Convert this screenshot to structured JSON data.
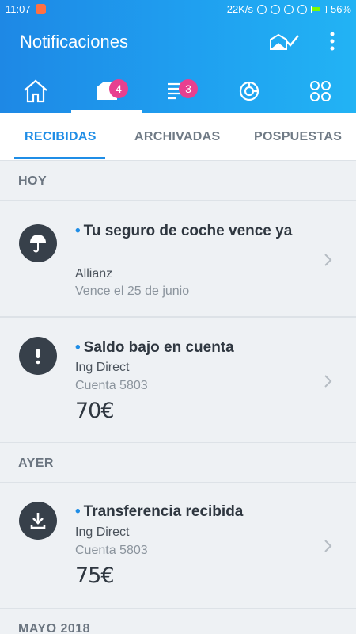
{
  "status_bar": {
    "time": "11:07",
    "speed": "22K/s",
    "battery": "56%"
  },
  "header": {
    "title": "Notificaciones"
  },
  "nav_tabs": [
    {
      "name": "inicio",
      "badge": ""
    },
    {
      "name": "notificaciones",
      "badge": "4"
    },
    {
      "name": "movimientos",
      "badge": "3"
    },
    {
      "name": "analisis",
      "badge": ""
    },
    {
      "name": "mas",
      "badge": ""
    }
  ],
  "subtabs": {
    "received": "RECIBIDAS",
    "archived": "ARCHIVADAS",
    "postponed": "POSPUESTAS"
  },
  "sections": {
    "today": "HOY",
    "yesterday": "AYER",
    "may": "MAYO 2018"
  },
  "notifications": [
    {
      "title": "Tu seguro de coche vence ya",
      "line1": "Allianz",
      "line2": "Vence el 25 de junio",
      "amount": "",
      "icon": "umbrella-icon"
    },
    {
      "title": "Saldo bajo en cuenta",
      "line1": "Ing Direct",
      "line2": "Cuenta 5803",
      "amount": "70€",
      "icon": "alert-icon"
    },
    {
      "title": "Transferencia recibida",
      "line1": "Ing Direct",
      "line2": "Cuenta 5803",
      "amount": "75€",
      "icon": "download-icon"
    }
  ],
  "colors": {
    "primary": "#1f8de6",
    "badge": "#e8408f",
    "header_start": "#1e88e5",
    "header_end": "#22b3f4"
  }
}
